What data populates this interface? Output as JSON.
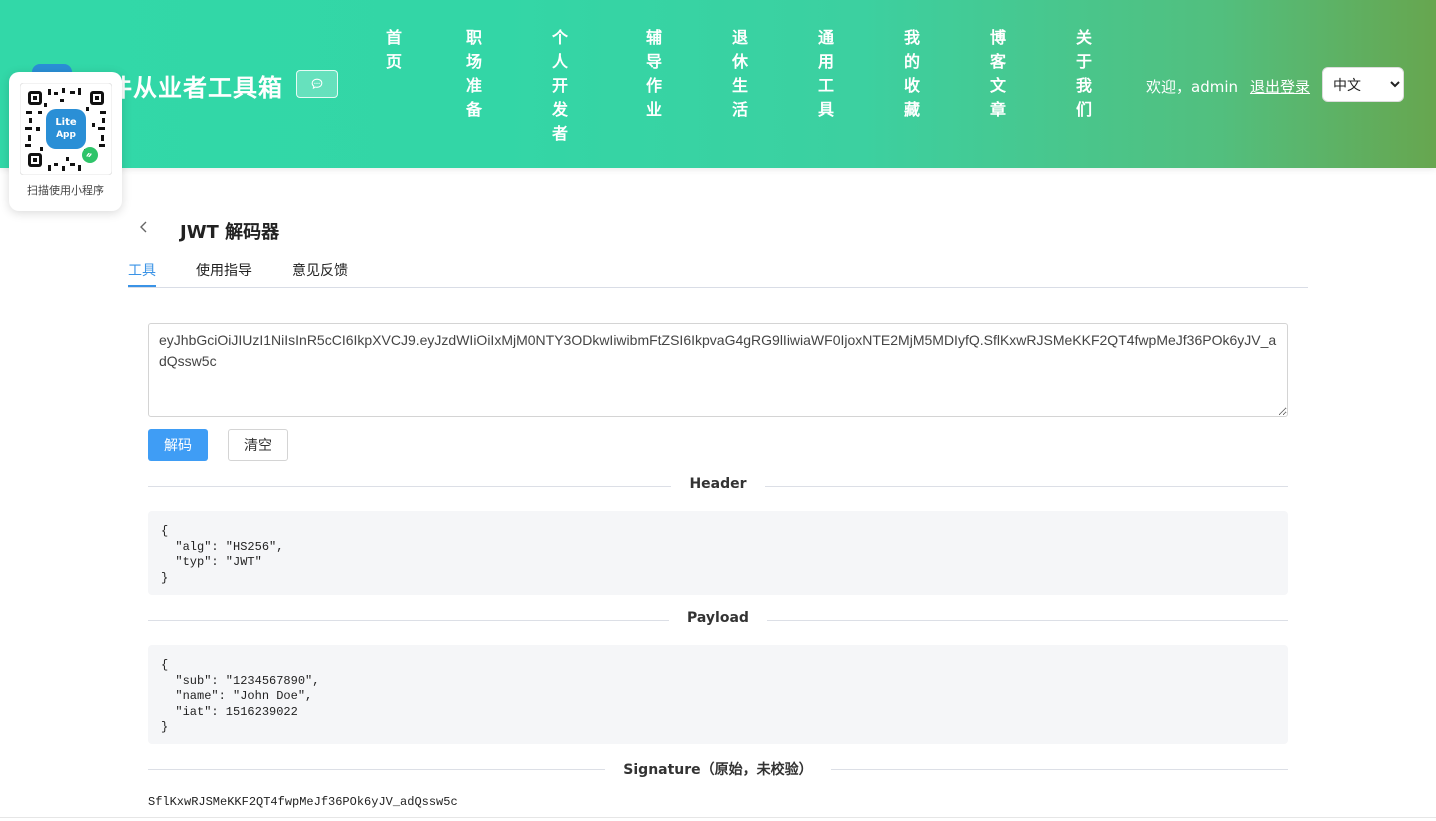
{
  "header": {
    "site_title": "件从业者工具箱",
    "welcome": "欢迎，admin",
    "logout_label": "退出登录",
    "language_selected": "中文",
    "gradient_start": "#32d8a8",
    "gradient_end": "#67a64f"
  },
  "nav": {
    "items": [
      "首页",
      "职场准备",
      "个人开发者",
      "辅导作业",
      "退休生活",
      "通用工具",
      "我的收藏",
      "博客文章",
      "关于我们"
    ]
  },
  "qr_popup": {
    "logo_text_top": "Lite",
    "logo_text_bottom": "App",
    "caption": "扫描使用小程序"
  },
  "page": {
    "title": "JWT 解码器",
    "tabs": [
      {
        "label": "工具",
        "active": true
      },
      {
        "label": "使用指导",
        "active": false
      },
      {
        "label": "意见反馈",
        "active": false
      }
    ],
    "token_value": "eyJhbGciOiJIUzI1NiIsInR5cCI6IkpXVCJ9.eyJzdWIiOiIxMjM0NTY3ODkwIiwibmFtZSI6IkpvaG4gRG9lIiwiaWF0IjoxNTE2MjM5MDIyfQ.SflKxwRJSMeKKF2QT4fwpMeJf36POk6yJV_adQssw5c",
    "decode_label": "解码",
    "clear_label": "清空",
    "header_section": "Header",
    "header_json": "{\n  \"alg\": \"HS256\",\n  \"typ\": \"JWT\"\n}",
    "payload_section": "Payload",
    "payload_json": "{\n  \"sub\": \"1234567890\",\n  \"name\": \"John Doe\",\n  \"iat\": 1516239022\n}",
    "signature_section": "Signature（原始，未校验）",
    "signature_value": "SflKxwRJSMeKKF2QT4fwpMeJf36POk6yJV_adQssw5c",
    "accent_color": "#3a93e6"
  }
}
